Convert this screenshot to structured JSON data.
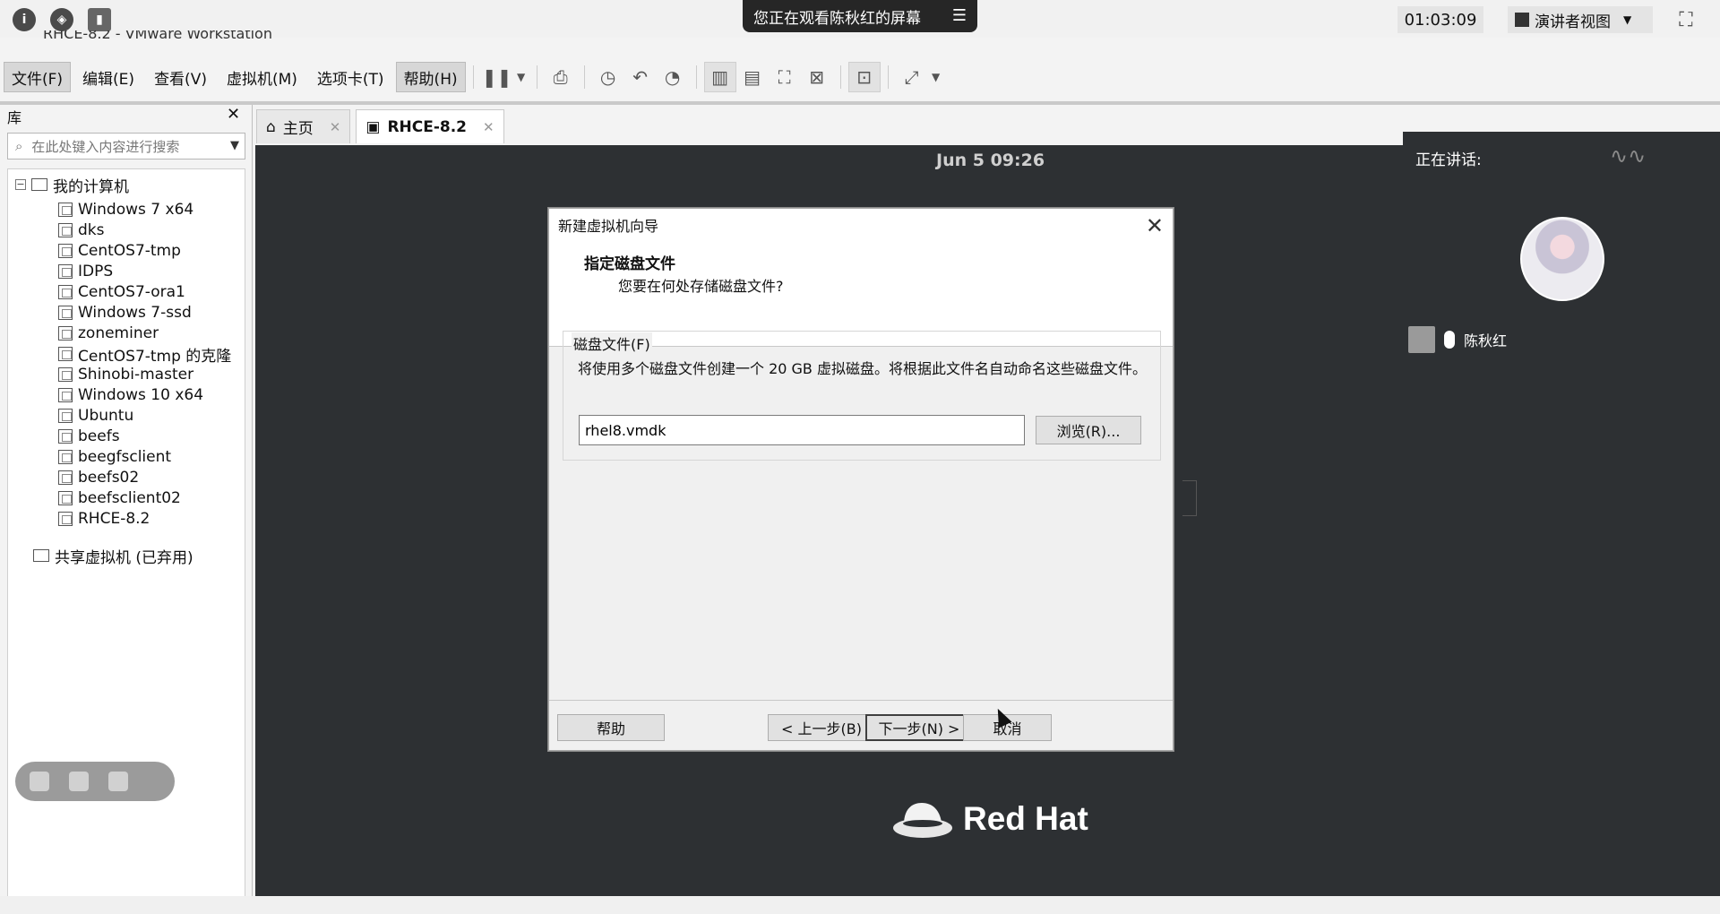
{
  "meeting": {
    "share_banner": "您正在观看陈秋红的屏幕",
    "timer": "01:03:09",
    "presenter_view": "演讲者视图",
    "speaking_label": "正在讲话:",
    "speaker_name": "陈秋红"
  },
  "vmware": {
    "title": "RHCE-8.2 - VMware Workstation",
    "menu": [
      "文件(F)",
      "编辑(E)",
      "查看(V)",
      "虚拟机(M)",
      "选项卡(T)",
      "帮助(H)"
    ],
    "library_title": "库",
    "search_placeholder": "在此处键入内容进行搜索",
    "tree": {
      "root": "我的计算机",
      "vms": [
        "Windows 7 x64",
        "dks",
        "CentOS7-tmp",
        "IDPS",
        "CentOS7-ora1",
        "Windows 7-ssd",
        "zoneminer",
        "CentOS7-tmp 的克隆",
        "Shinobi-master",
        "Windows 10 x64",
        "Ubuntu",
        "beefs",
        "beegfsclient",
        "beefs02",
        "beefsclient02",
        "RHCE-8.2"
      ],
      "shared": "共享虚拟机 (已弃用)"
    },
    "tabs": [
      {
        "label": "主页"
      },
      {
        "label": "RHCE-8.2"
      }
    ],
    "console_clock": "Jun 5  09:26",
    "brand": "Red Hat"
  },
  "dialog": {
    "title": "新建虚拟机向导",
    "heading": "指定磁盘文件",
    "subheading": "您要在何处存储磁盘文件?",
    "group_label": "磁盘文件(F)",
    "description": "将使用多个磁盘文件创建一个 20 GB 虚拟磁盘。将根据此文件名自动命名这些磁盘文件。",
    "file_value": "rhel8.vmdk",
    "browse_label": "浏览(R)...",
    "help_label": "帮助",
    "back_label": "< 上一步(B)",
    "next_label": "下一步(N) >",
    "cancel_label": "取消"
  }
}
